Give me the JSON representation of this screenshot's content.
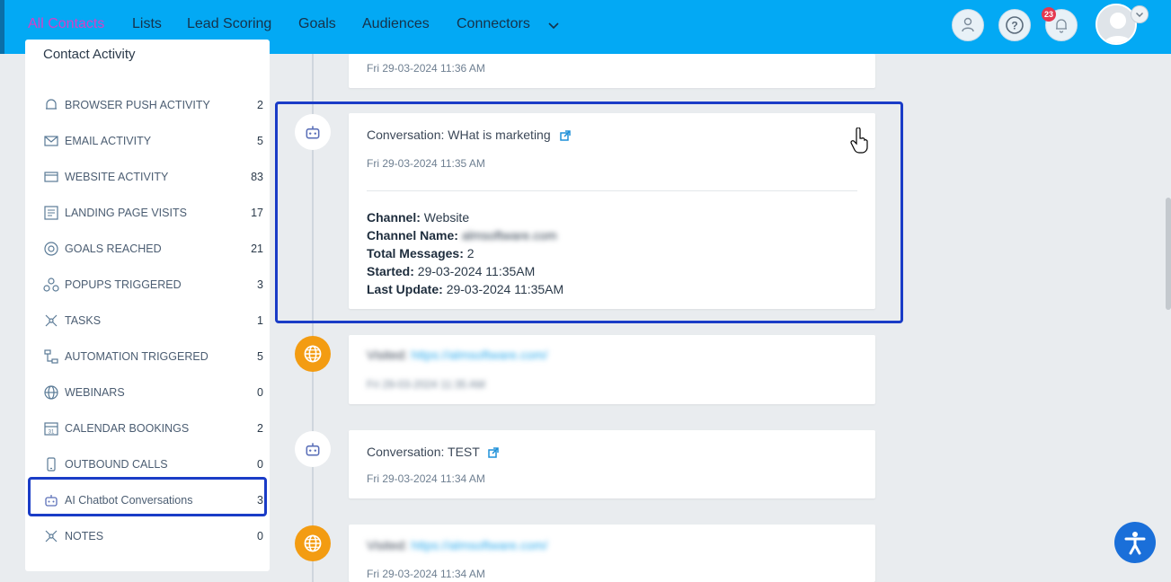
{
  "nav": {
    "tabs": [
      {
        "label": "All Contacts"
      },
      {
        "label": "Lists"
      },
      {
        "label": "Lead Scoring"
      },
      {
        "label": "Goals"
      },
      {
        "label": "Audiences"
      },
      {
        "label": "Connectors"
      }
    ],
    "notification_count": "23",
    "accent_color": "#c94fc8",
    "bar_color": "#03a9f4"
  },
  "sidebar": {
    "title": "Contact Activity",
    "items": [
      {
        "label": "BROWSER PUSH ACTIVITY",
        "count": "2",
        "icon": "bell-push-icon"
      },
      {
        "label": "EMAIL ACTIVITY",
        "count": "5",
        "icon": "envelope-icon"
      },
      {
        "label": "WEBSITE ACTIVITY",
        "count": "83",
        "icon": "browser-window-icon"
      },
      {
        "label": "LANDING PAGE VISITS",
        "count": "17",
        "icon": "landing-page-icon"
      },
      {
        "label": "GOALS REACHED",
        "count": "21",
        "icon": "target-icon"
      },
      {
        "label": "POPUPS TRIGGERED",
        "count": "3",
        "icon": "popup-icon"
      },
      {
        "label": "TASKS",
        "count": "1",
        "icon": "tasks-icon"
      },
      {
        "label": "AUTOMATION TRIGGERED",
        "count": "5",
        "icon": "automation-icon"
      },
      {
        "label": "WEBINARS",
        "count": "0",
        "icon": "globe-icon"
      },
      {
        "label": "CALENDAR BOOKINGS",
        "count": "2",
        "icon": "calendar-icon"
      },
      {
        "label": "OUTBOUND CALLS",
        "count": "0",
        "icon": "phone-icon"
      },
      {
        "label": "AI Chatbot Conversations",
        "count": "3",
        "icon": "robot-icon"
      },
      {
        "label": "NOTES",
        "count": "0",
        "icon": "notes-icon"
      }
    ]
  },
  "timeline": {
    "card0": {
      "date": "Fri 29-03-2024 11:36 AM"
    },
    "card1": {
      "title": "Conversation: WHat is marketing",
      "date": "Fri 29-03-2024 11:35 AM",
      "channel_label": "Channel:",
      "channel_value": "Website",
      "channel_name_label": "Channel Name:",
      "channel_name_value": "almsoftware.com",
      "total_label": "Total Messages:",
      "total_value": "2",
      "started_label": "Started:",
      "started_value": "29-03-2024 11:35AM",
      "updated_label": "Last Update:",
      "updated_value": "29-03-2024 11:35AM"
    },
    "card2": {
      "prefix": "Visited:",
      "link": "https://almsoftware.com/",
      "date": "Fri 29-03-2024 11:35 AM"
    },
    "card3": {
      "title": "Conversation: TEST",
      "date": "Fri 29-03-2024 11:34 AM"
    },
    "card4": {
      "prefix": "Visited:",
      "link": "https://almsoftware.com/",
      "date": "Fri 29-03-2024 11:34 AM"
    }
  }
}
